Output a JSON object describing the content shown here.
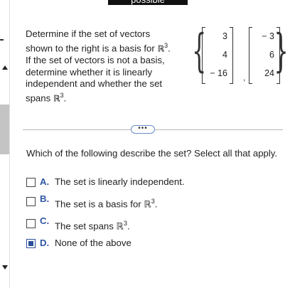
{
  "header": {
    "banner_text": "possible"
  },
  "question": {
    "text_before": "Determine if the set of vectors shown to the right is a basis for ",
    "space": "ℝ",
    "space_exp": "3",
    "text_middle": ". If the set of vectors is not a basis, determine whether it is linearly independent and whether the set spans ",
    "space2": "ℝ",
    "space2_exp": "3",
    "text_end": "."
  },
  "vectors": [
    [
      "3",
      "4",
      "− 16"
    ],
    [
      "− 3",
      "6",
      "24"
    ]
  ],
  "more_button": "•••",
  "prompt": "Which of the following describe the set? Select all that apply.",
  "options": [
    {
      "letter": "A.",
      "text": "The set is linearly independent.",
      "exp": "",
      "tail": "",
      "checked": false
    },
    {
      "letter": "B.",
      "text": "The set is a basis for ℝ",
      "exp": "3",
      "tail": ".",
      "checked": false
    },
    {
      "letter": "C.",
      "text": "The set spans ℝ",
      "exp": "3",
      "tail": ".",
      "checked": false
    },
    {
      "letter": "D.",
      "text": "None of the above",
      "exp": "",
      "tail": "",
      "checked": true
    }
  ],
  "colors": {
    "accent": "#2f55a4",
    "checked_fill": "#2b4f9a",
    "divider": "#b9b9b9"
  }
}
